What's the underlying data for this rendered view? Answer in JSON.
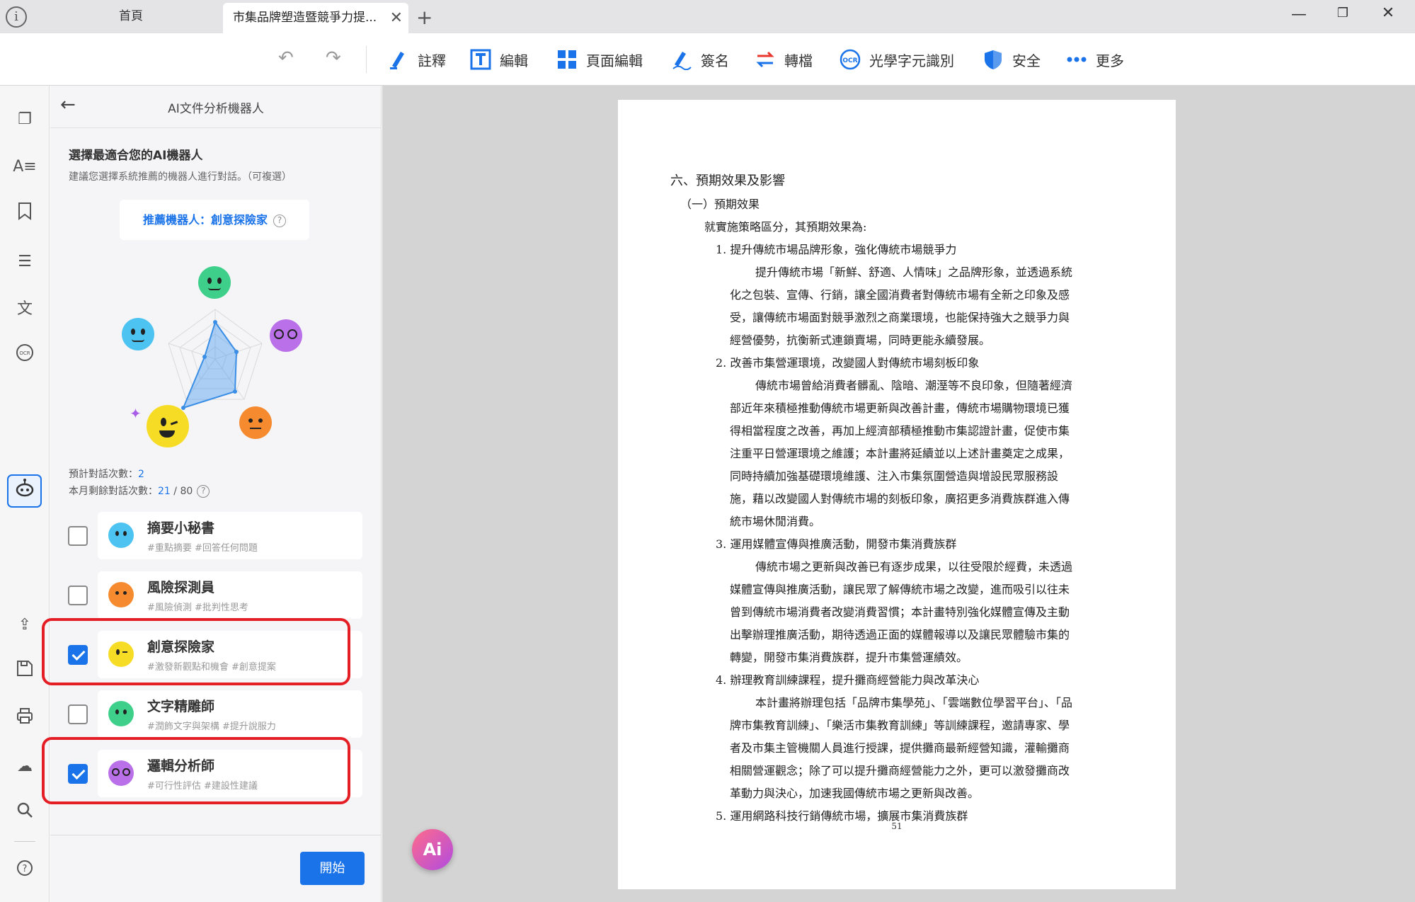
{
  "tabs": {
    "home": "首頁",
    "active": "市集品牌塑造暨競爭力提...",
    "close": "✕",
    "add": "+"
  },
  "window": {
    "minimize": "—",
    "maximize": "❐",
    "close": "✕"
  },
  "toolbar": {
    "annotate": "註釋",
    "edit": "編輯",
    "page_edit": "頁面編輯",
    "sign": "簽名",
    "convert": "轉檔",
    "ocr": "光學字元識別",
    "security": "安全",
    "more": "更多"
  },
  "panel": {
    "title": "AI文件分析機器人",
    "heading": "選擇最適合您的AI機器人",
    "subheading": "建議您選擇系統推薦的機器人進行對話。（可複選）",
    "recommend_label": "推薦機器人：創意探險家",
    "stat_expected_label": "預計對話次數：",
    "stat_expected_value": "2",
    "stat_remaining_label": "本月剩餘對話次數：",
    "stat_remaining_value": "21",
    "stat_remaining_total": "/ 80",
    "start": "開始"
  },
  "bots": [
    {
      "name": "摘要小秘書",
      "tags": "#重點摘要 #回答任何問題",
      "checked": false,
      "color": "#4cc3f0"
    },
    {
      "name": "風險探測員",
      "tags": "#風險偵測 #批判性思考",
      "checked": false,
      "color": "#f58a2e"
    },
    {
      "name": "創意探險家",
      "tags": "#激發新觀點和機會 #創意提案",
      "checked": true,
      "color": "#f7dc25"
    },
    {
      "name": "文字精雕師",
      "tags": "#潤飾文字與架構 #提升說服力",
      "checked": false,
      "color": "#3ed08b"
    },
    {
      "name": "邏輯分析師",
      "tags": "#可行性評估 #建設性建議",
      "checked": true,
      "color": "#b970e8"
    }
  ],
  "document": {
    "lines": [
      "六、預期效果及影響",
      "（一）預期效果",
      "就實施策略區分，其預期效果為:",
      "1. 提升傳統市場品牌形象，強化傳統市場競爭力",
      "提升傳統市場「新鮮、舒適、人情味」之品牌形象，並透過系統",
      "化之包裝、宣傳、行銷，讓全國消費者對傳統市場有全新之印象及感",
      "受，讓傳統市場面對競爭激烈之商業環境，也能保持強大之競爭力與",
      "經營優勢，抗衡新式連鎖賣場，同時更能永續發展。",
      "2. 改善市集營運環境，改變國人對傳統市場刻板印象",
      "傳統市場曾給消費者髒亂、陰暗、潮溼等不良印象，但隨著經濟",
      "部近年來積極推動傳統市場更新與改善計畫，傳統市場購物環境已獲",
      "得相當程度之改善，再加上經濟部積極推動市集認證計畫，促使市集",
      "注重平日營運環境之維護；本計畫將延續並以上述計畫奠定之成果，",
      "同時持續加強基礎環境維護、注入市集氛圍營造與增設民眾服務設",
      "施，藉以改變國人對傳統市場的刻板印象，廣招更多消費族群進入傳",
      "統市場休閒消費。",
      "3. 運用媒體宣傳與推廣活動，開發市集消費族群",
      "傳統市場之更新與改善已有逐步成果，以往受限於經費，未透過",
      "媒體宣傳與推廣活動，讓民眾了解傳統市場之改變，進而吸引以往未",
      "曾到傳統市場消費者改變消費習慣；本計畫特別強化媒體宣傳及主動",
      "出擊辦理推廣活動，期待透過正面的媒體報導以及讓民眾體驗市集的",
      "轉變，開發市集消費族群，提升市集營運績效。",
      "4. 辦理教育訓練課程，提升攤商經營能力與改革決心",
      "本計畫將辦理包括「品牌市集學苑」、「雲端數位學習平台」、「品",
      "牌市集教育訓練」、「樂活市集教育訓練」等訓練課程，邀請專家、學",
      "者及市集主管機關人員進行授課，提供攤商最新經營知識，灌輸攤商",
      "相關營運觀念；除了可以提升攤商經營能力之外，更可以激發攤商改",
      "革動力與決心，加速我國傳統市場之更新與改善。",
      "5. 運用網路科技行銷傳統市場，擴展市集消費族群"
    ],
    "page_number": "51"
  },
  "ai_fab": "Ai"
}
